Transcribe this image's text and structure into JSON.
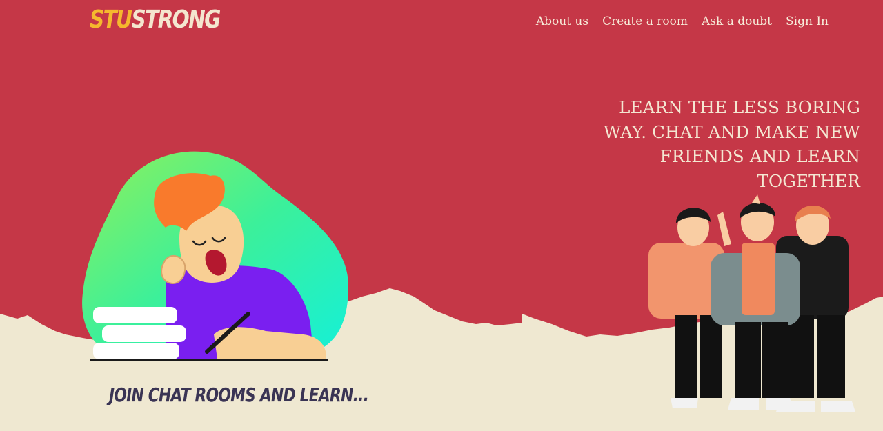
{
  "header": {
    "logo": {
      "part1": "STU",
      "part2": "STRONG"
    },
    "nav": [
      {
        "label": "About us"
      },
      {
        "label": "Create a room"
      },
      {
        "label": "Ask a doubt"
      },
      {
        "label": "Sign In"
      }
    ]
  },
  "hero": {
    "tagline": "LEARN THE LESS BORING WAY. CHAT AND MAKE NEW FRIENDS AND LEARN TOGETHER",
    "caption": "JOIN CHAT ROOMS AND LEARN..."
  },
  "colors": {
    "primary_bg": "#c53747",
    "paper_bg": "#efe8d1",
    "logo_accent": "#f5b82e",
    "nav_text": "#f7ecd9",
    "caption_text": "#3a3454"
  },
  "icons": [
    "studying-student-illustration",
    "three-friends-illustration"
  ]
}
